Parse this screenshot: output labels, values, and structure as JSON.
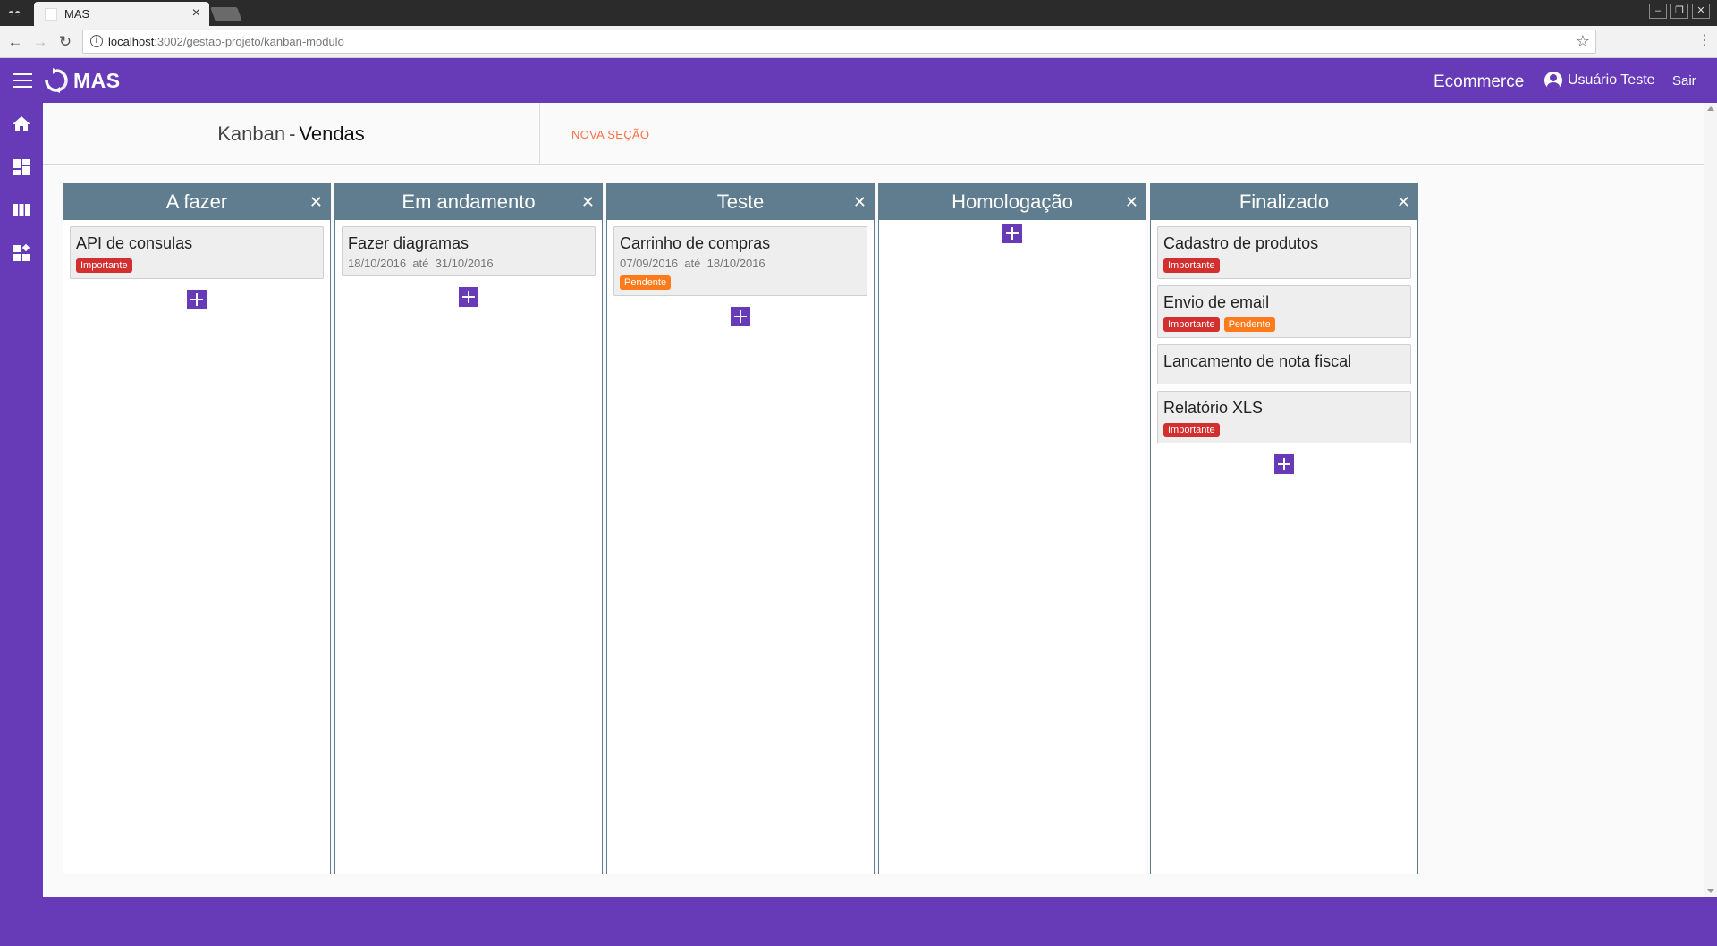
{
  "browser": {
    "tab_title": "MAS",
    "url_host": "localhost",
    "url_rest": ":3002/gestao-projeto/kanban-modulo"
  },
  "header": {
    "logo_text": "MAS",
    "project": "Ecommerce",
    "user": "Usuário Teste",
    "logout": "Sair"
  },
  "page": {
    "title_prefix": "Kanban",
    "title_sep": "-",
    "title_project": "Vendas",
    "new_section": "NOVA SEÇÃO"
  },
  "columns": [
    {
      "title": "A fazer",
      "cards": [
        {
          "title": "API de consulas",
          "tags": [
            "Importante"
          ]
        }
      ]
    },
    {
      "title": "Em andamento",
      "cards": [
        {
          "title": "Fazer diagramas",
          "dates": "18/10/2016  até  31/10/2016"
        }
      ]
    },
    {
      "title": "Teste",
      "cards": [
        {
          "title": "Carrinho de compras",
          "dates": "07/09/2016  até  18/10/2016",
          "tags": [
            "Pendente"
          ]
        }
      ]
    },
    {
      "title": "Homologação",
      "cards": []
    },
    {
      "title": "Finalizado",
      "cards": [
        {
          "title": "Cadastro de produtos",
          "tags": [
            "Importante"
          ]
        },
        {
          "title": "Envio de email",
          "tags": [
            "Importante",
            "Pendente"
          ]
        },
        {
          "title": "Lancamento de nota fiscal"
        },
        {
          "title": "Relatório XLS",
          "tags": [
            "Importante"
          ]
        }
      ]
    }
  ],
  "tag_colors": {
    "Importante": "#d32f2f",
    "Pendente": "#ff7a1a"
  },
  "theme": {
    "primary": "#673ab7",
    "column_header": "#5f7d8e",
    "accent": "#ff7043"
  }
}
